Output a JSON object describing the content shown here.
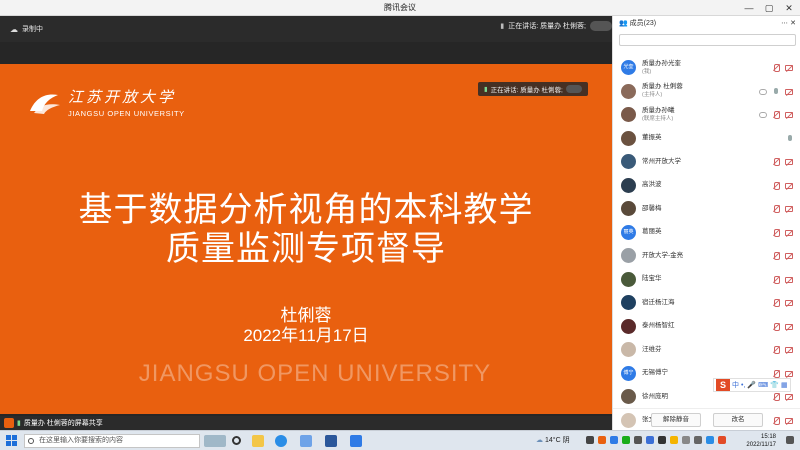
{
  "window": {
    "title": "腾讯会议"
  },
  "recording": {
    "label": "录制中"
  },
  "speaking": {
    "label": "正在讲话: 质量办 杜俐蓉;"
  },
  "slide": {
    "logo_cn": "江苏开放大学",
    "logo_en": "JIANGSU OPEN UNIVERSITY",
    "title_line1": "基于数据分析视角的本科教学",
    "title_line2": "质量监测专项督导",
    "author": "杜俐蓉",
    "date": "2022年11月17日",
    "watermark": "JIANGSU OPEN UNIVERSITY",
    "badge": "正在讲话: 质量办 杜俐蓉;"
  },
  "share": {
    "label": "质量办 杜俐蓉的屏幕共享"
  },
  "panel": {
    "title": "成员(23)",
    "members": [
      {
        "name": "质量办孙光奎",
        "role": "(我)",
        "avatar": "光奎",
        "color": "#2f7be6",
        "mic": "muted",
        "cam": "off"
      },
      {
        "name": "质量办 杜俐蓉",
        "role": "(主持人)",
        "avatar": "",
        "color": "#8a6a5a",
        "mic": "on",
        "cam": "off"
      },
      {
        "name": "质量办孙曦",
        "role": "(联席主持人)",
        "avatar": "",
        "color": "#7a5a4a",
        "mic": "muted",
        "cam": "off"
      },
      {
        "name": "董振英",
        "role": "",
        "avatar": "",
        "color": "#6b5240",
        "mic": "on",
        "cam": ""
      },
      {
        "name": "常州开放大学",
        "role": "",
        "avatar": "",
        "color": "#3a5a78",
        "mic": "muted",
        "cam": "off"
      },
      {
        "name": "高洪波",
        "role": "",
        "avatar": "",
        "color": "#2c3e50",
        "mic": "muted",
        "cam": "off"
      },
      {
        "name": "邵馨梅",
        "role": "",
        "avatar": "",
        "color": "#5a4a3a",
        "mic": "muted",
        "cam": "off"
      },
      {
        "name": "葛丽英",
        "role": "",
        "avatar": "丽英",
        "color": "#2f7be6",
        "mic": "muted",
        "cam": "off"
      },
      {
        "name": "开放大学-金亮",
        "role": "",
        "avatar": "",
        "color": "#9aa0a6",
        "mic": "muted",
        "cam": "off"
      },
      {
        "name": "陆宝华",
        "role": "",
        "avatar": "",
        "color": "#4a5a3a",
        "mic": "muted",
        "cam": "off"
      },
      {
        "name": "宿迁杨江海",
        "role": "",
        "avatar": "",
        "color": "#1f4060",
        "mic": "muted",
        "cam": "off"
      },
      {
        "name": "泰州杨智红",
        "role": "",
        "avatar": "",
        "color": "#5a2a2a",
        "mic": "muted",
        "cam": "off"
      },
      {
        "name": "汪维芬",
        "role": "",
        "avatar": "",
        "color": "#c9b8a8",
        "mic": "muted",
        "cam": "off"
      },
      {
        "name": "无锡傅宁",
        "role": "",
        "avatar": "傅宁",
        "color": "#2f7be6",
        "mic": "muted",
        "cam": "off"
      },
      {
        "name": "徐州庞明",
        "role": "",
        "avatar": "",
        "color": "#6a5a4a",
        "mic": "muted",
        "cam": "off"
      },
      {
        "name": "张文利",
        "role": "",
        "avatar": "",
        "color": "#d4c4b4",
        "mic": "muted",
        "cam": "off"
      }
    ],
    "mute_all": "解除静音",
    "rename": "改名",
    "ime": {
      "zh": "中"
    }
  },
  "taskbar": {
    "search_placeholder": "在这里输入你要搜索的内容",
    "weather": "14°C 阴",
    "time": "15:18",
    "date": "2022/11/17"
  },
  "colors": {
    "slide_bg": "#e9600f",
    "accent": "#2f7be6",
    "muted": "#d06060"
  }
}
